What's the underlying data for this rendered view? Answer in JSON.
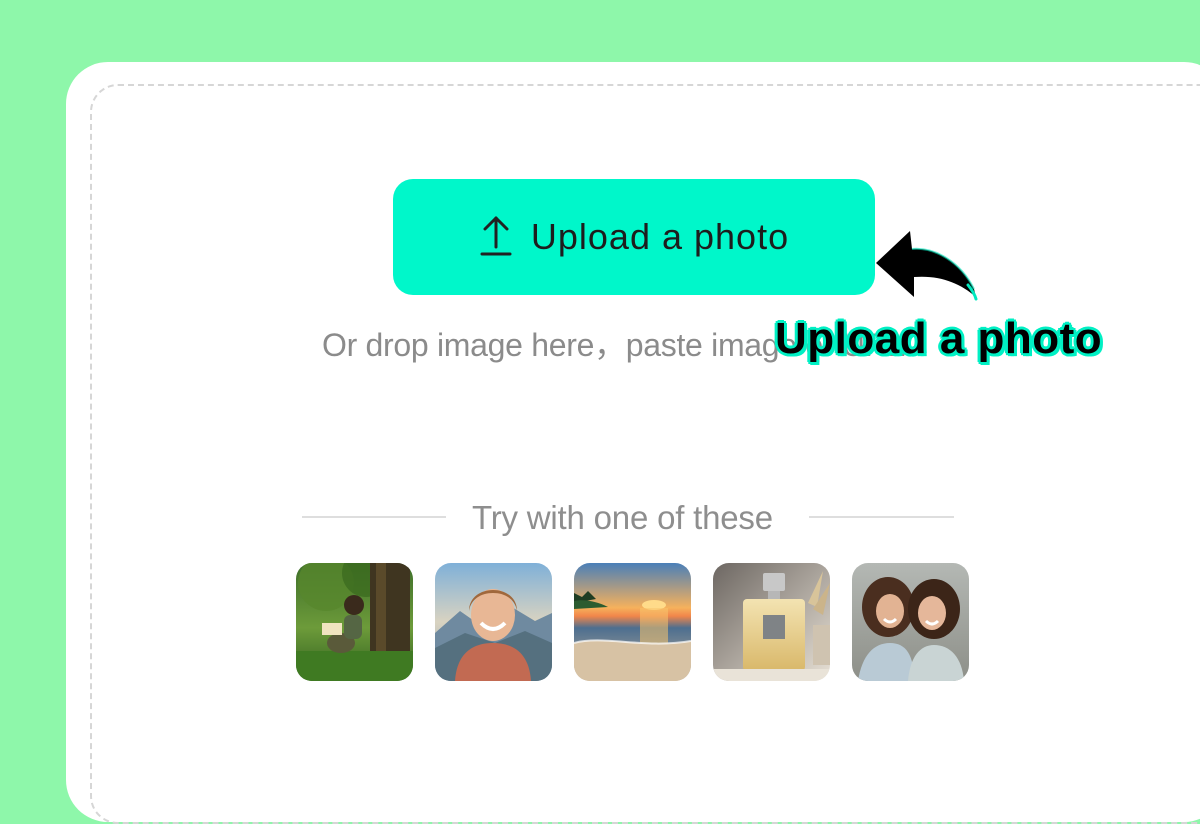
{
  "upload": {
    "button_label": "Upload a photo",
    "icon": "upload-arrow-icon",
    "drop_text": "Or drop image here，paste image or URL"
  },
  "callout": {
    "caption": "Upload a photo",
    "arrow_icon": "curved-arrow-icon"
  },
  "samples": {
    "heading": "Try with one of these",
    "items": [
      {
        "icon": "sample-reading-under-tree"
      },
      {
        "icon": "sample-smiling-woman-mountains"
      },
      {
        "icon": "sample-beach-sunset"
      },
      {
        "icon": "sample-perfume-bottle"
      },
      {
        "icon": "sample-two-women"
      }
    ]
  },
  "colors": {
    "background": "#8ef7aa",
    "accent": "#00f7ca",
    "card": "#ffffff"
  }
}
